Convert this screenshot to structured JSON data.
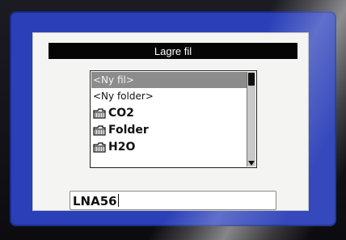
{
  "dialog": {
    "title": "Lagre fil"
  },
  "file_list": {
    "items": [
      {
        "label": "<Ny fil>",
        "icon": "",
        "selected": true
      },
      {
        "label": "<Ny folder>",
        "icon": "",
        "selected": false
      },
      {
        "label": "CO2",
        "icon": "folder-icon",
        "selected": false
      },
      {
        "label": "Folder",
        "icon": "folder-icon",
        "selected": false
      },
      {
        "label": "H2O",
        "icon": "folder-icon",
        "selected": false
      }
    ]
  },
  "filename_input": {
    "value": "LNA56"
  },
  "colors": {
    "screen_border": "#2a3fb8",
    "title_bar": "#050505",
    "selection": "#8c8c8c"
  }
}
